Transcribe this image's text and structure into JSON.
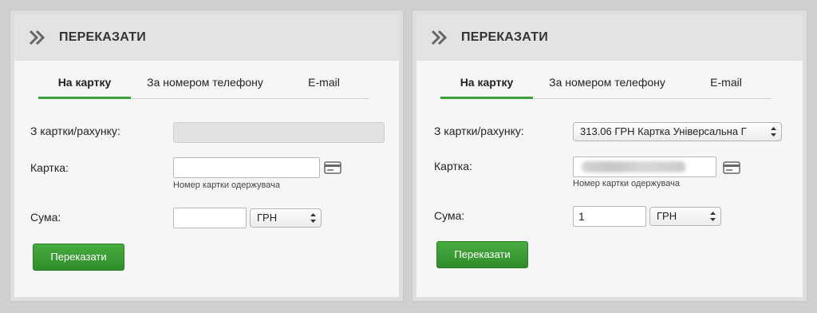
{
  "left": {
    "header": {
      "title": "ПЕРЕКАЗАТИ"
    },
    "tabs": [
      {
        "label": "На картку"
      },
      {
        "label": "За номером телефону"
      },
      {
        "label": "E-mail"
      }
    ],
    "form": {
      "from_label": "З картки/рахунку:",
      "card_label": "Картка:",
      "card_value": "",
      "card_hint": "Номер картки одержувача",
      "amount_label": "Сума:",
      "amount_value": "",
      "currency": "ГРН",
      "submit_label": "Переказати"
    }
  },
  "right": {
    "header": {
      "title": "ПЕРЕКАЗАТИ"
    },
    "tabs": [
      {
        "label": "На картку"
      },
      {
        "label": "За номером телефону"
      },
      {
        "label": "E-mail"
      }
    ],
    "form": {
      "from_label": "З картки/рахунку:",
      "from_value": "313.06 ГРН  Картка Універсальна Г",
      "card_label": "Картка:",
      "card_hint": "Номер картки одержувача",
      "amount_label": "Сума:",
      "amount_value": "1",
      "currency": "ГРН",
      "submit_label": "Переказати"
    }
  },
  "colors": {
    "accent": "#3aa13a",
    "button": "#3a9a34"
  },
  "icons": {
    "header": "double-chevron-right-icon",
    "card": "credit-card-icon",
    "select": "select-arrows-icon"
  }
}
